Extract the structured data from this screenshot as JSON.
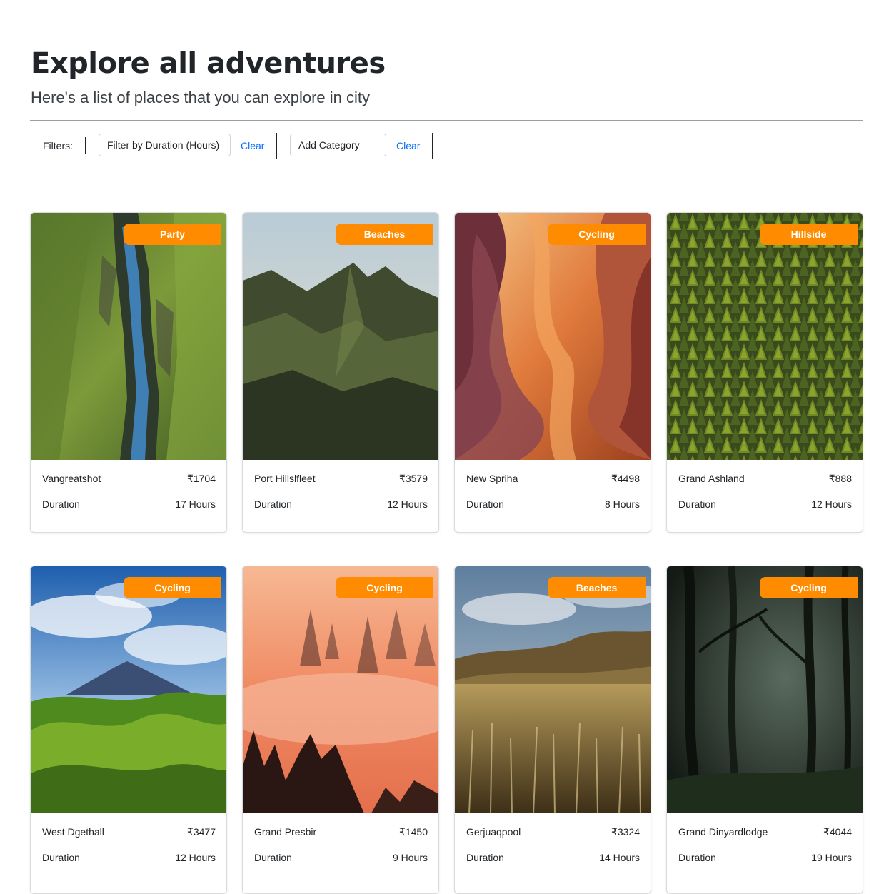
{
  "header": {
    "title": "Explore all adventures",
    "subtitle": "Here's a list of places that you can explore in city"
  },
  "filters": {
    "label": "Filters:",
    "duration_select": "Filter by Duration (Hours)",
    "duration_clear": "Clear",
    "category_select": "Add Category",
    "category_clear": "Clear"
  },
  "colors": {
    "badge": "#ff8c00",
    "link": "#0d6efd"
  },
  "cards": [
    {
      "category": "Party",
      "name": "Vangreatshot",
      "price": "₹1704",
      "duration_label": "Duration",
      "duration": "17 Hours",
      "image": "aerial-canyon-river"
    },
    {
      "category": "Beaches",
      "name": "Port Hillslfleet",
      "price": "₹3579",
      "duration_label": "Duration",
      "duration": "12 Hours",
      "image": "green-mountain-peaks"
    },
    {
      "category": "Cycling",
      "name": "New Spriha",
      "price": "₹4498",
      "duration_label": "Duration",
      "duration": "8 Hours",
      "image": "slot-canyon"
    },
    {
      "category": "Hillside",
      "name": "Grand Ashland",
      "price": "₹888",
      "duration_label": "Duration",
      "duration": "12 Hours",
      "image": "pine-forest-aerial"
    },
    {
      "category": "Cycling",
      "name": "West Dgethall",
      "price": "₹3477",
      "duration_label": "Duration",
      "duration": "12 Hours",
      "image": "volcano-green-hills"
    },
    {
      "category": "Cycling",
      "name": "Grand Presbir",
      "price": "₹1450",
      "duration_label": "Duration",
      "duration": "9 Hours",
      "image": "misty-forest-sunset"
    },
    {
      "category": "Beaches",
      "name": "Gerjuaqpool",
      "price": "₹3324",
      "duration_label": "Duration",
      "duration": "14 Hours",
      "image": "golden-grass-field"
    },
    {
      "category": "Cycling",
      "name": "Grand Dinyardlodge",
      "price": "₹4044",
      "duration_label": "Duration",
      "duration": "19 Hours",
      "image": "dark-forest"
    }
  ]
}
